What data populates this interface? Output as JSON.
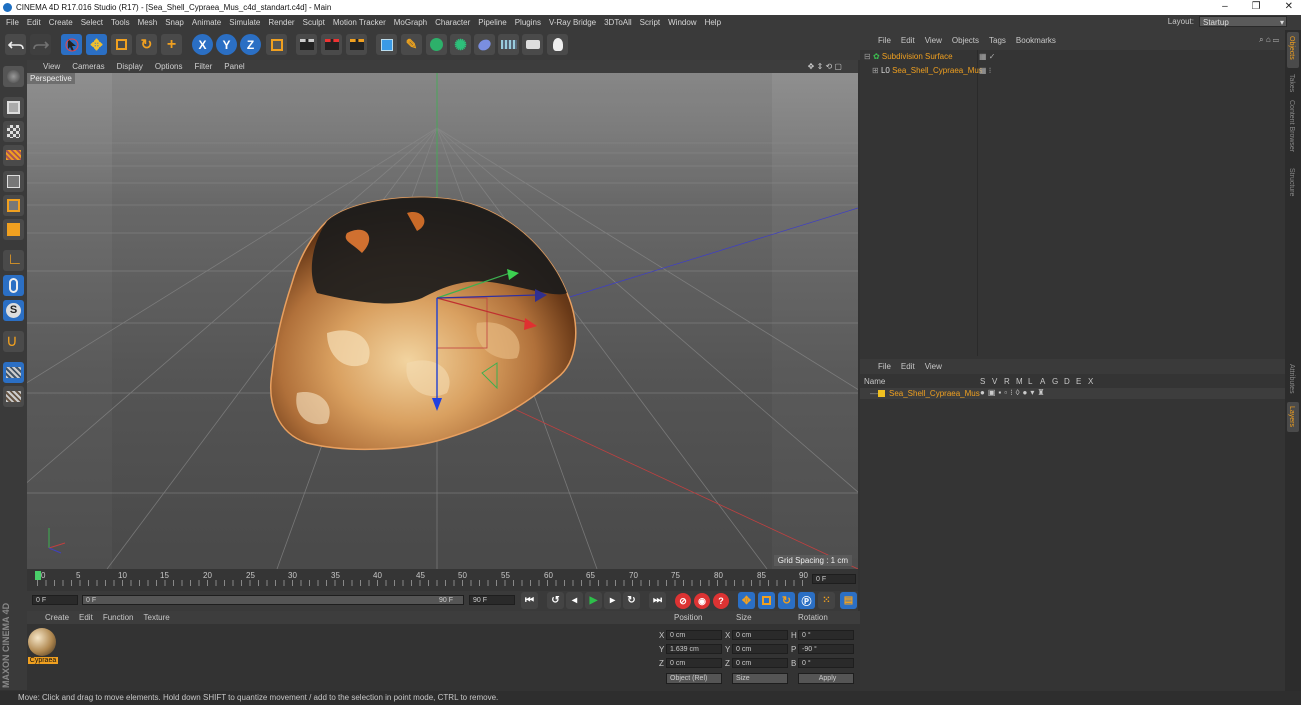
{
  "window": {
    "title": "CINEMA 4D R17.016 Studio (R17) - [Sea_Shell_Cypraea_Mus_c4d_standart.c4d] - Main",
    "minimize": "–",
    "restore": "❐",
    "close": "✕"
  },
  "menu": [
    "File",
    "Edit",
    "Create",
    "Select",
    "Tools",
    "Mesh",
    "Snap",
    "Animate",
    "Simulate",
    "Render",
    "Sculpt",
    "Motion Tracker",
    "MoGraph",
    "Character",
    "Pipeline",
    "Plugins",
    "V-Ray Bridge",
    "3DToAll",
    "Script",
    "Window",
    "Help"
  ],
  "layout": {
    "label": "Layout:",
    "value": "Startup"
  },
  "viewport": {
    "menu": [
      "View",
      "Cameras",
      "Display",
      "Options",
      "Filter",
      "Panel"
    ],
    "label": "Perspective",
    "grid_spacing": "Grid Spacing : 1 cm"
  },
  "timeline": {
    "ticks": [
      "0",
      "5",
      "10",
      "15",
      "20",
      "25",
      "30",
      "35",
      "40",
      "45",
      "50",
      "55",
      "60",
      "65",
      "70",
      "75",
      "80",
      "85",
      "90"
    ],
    "current_frame": "0 F"
  },
  "transport": {
    "start": "0 F",
    "slider_start": "0 F",
    "slider_end": "90 F",
    "end": "90 F"
  },
  "material_panel": {
    "menu": [
      "Create",
      "Edit",
      "Function",
      "Texture"
    ],
    "material_name": "Cypraea"
  },
  "coord_panel": {
    "headers": [
      "Position",
      "Size",
      "Rotation"
    ],
    "rows": [
      {
        "axis": "X",
        "pos": "0 cm",
        "size_axis": "X",
        "size": "0 cm",
        "rot_axis": "H",
        "rot": "0 °"
      },
      {
        "axis": "Y",
        "pos": "1.639 cm",
        "size_axis": "Y",
        "size": "0 cm",
        "rot_axis": "P",
        "rot": "-90 °"
      },
      {
        "axis": "Z",
        "pos": "0 cm",
        "size_axis": "Z",
        "size": "0 cm",
        "rot_axis": "B",
        "rot": "0 °"
      }
    ],
    "mode": "Object (Rel)",
    "size_mode": "Size",
    "apply": "Apply"
  },
  "object_manager": {
    "menu": [
      "File",
      "Edit",
      "View",
      "Objects",
      "Tags",
      "Bookmarks"
    ],
    "objects": [
      "Subdivision Surface",
      "Sea_Shell_Cypraea_Mus"
    ]
  },
  "layer_manager": {
    "menu": [
      "File",
      "Edit",
      "View"
    ],
    "columns": [
      "Name",
      "S",
      "V",
      "R",
      "M",
      "L",
      "A",
      "G",
      "D",
      "E",
      "X"
    ],
    "layers": [
      "Sea_Shell_Cypraea_Mus"
    ]
  },
  "side_tabs": [
    "Objects",
    "Takes",
    "Content Browser",
    "Structure",
    "Attributes",
    "Layers"
  ],
  "brand": "MAXON CINEMA 4D",
  "status": "Move: Click and drag to move elements. Hold down SHIFT to quantize movement / add to the selection in point mode, CTRL to remove.",
  "colors": {
    "accent": "#f0a020",
    "blue_tool": "#2b6fc4",
    "play": "#2dbf4a"
  }
}
